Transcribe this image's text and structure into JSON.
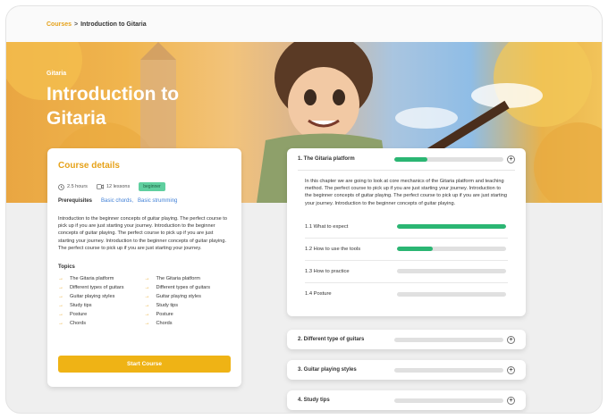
{
  "breadcrumb": {
    "link": "Courses",
    "separator": ">",
    "current": "Introduction to Gitaria"
  },
  "hero": {
    "subtitle": "Gitaria",
    "title": "Introduction to Gitaria"
  },
  "details": {
    "heading": "Course details",
    "duration": "2.5 hours",
    "lessons_count": "12 lessons",
    "level": "beginner",
    "prereq_label": "Prerequisites",
    "prereqs": [
      "Basic chords,",
      "Basic strumming"
    ],
    "description": "Introduction to the beginner concepts of guitar playing. The perfect course to pick up if you are just starting your journey. Introduction to the beginner concepts of guitar playing. The perfect course to pick up if you are just starting your journey. Introduction to the beginner concepts of guitar playing. The perfect course to pick up if you are just starting your journey.",
    "topics_label": "Topics",
    "topics_left": [
      "The Gitaria platform",
      "Different types of guitars",
      "Guitar playing styles",
      "Study tips",
      "Posture",
      "Chords"
    ],
    "topics_right": [
      "The Gitaria platform",
      "Different types of guitars",
      "Guitar playing styles",
      "Study tips",
      "Posture",
      "Chords"
    ],
    "start_button": "Start Course"
  },
  "chapters": [
    {
      "title": "1. The Gitaria platform",
      "progress": 0.3,
      "description": "In this chapter we are going to look at core mechanics of the Gitaria platform and teaching method. The perfect course to pick up if you are just starting your journey. Introduction to the beginner concepts of guitar playing. The perfect course to pick up if you are just starting your journey. Introduction to the beginner concepts of guitar playing.",
      "lessons": [
        {
          "title": "1.1  What to expect",
          "progress": 1.0
        },
        {
          "title": "1.2  How to use the tools",
          "progress": 0.33
        },
        {
          "title": "1.3  How to practice",
          "progress": 0
        },
        {
          "title": "1.4  Posture",
          "progress": 0
        }
      ]
    },
    {
      "title": "2.  Different type of guitars",
      "progress": 0
    },
    {
      "title": "3.  Guitar playing styles",
      "progress": 0
    },
    {
      "title": "4.  Study tips",
      "progress": 0
    }
  ],
  "colors": {
    "accent": "#e6a21a",
    "progress": "#2bb673",
    "button": "#efb315"
  },
  "icons": {
    "clock": "clock-icon",
    "video": "video-icon",
    "plus": "plus-circle-icon",
    "arrow": "arrow-right-icon"
  }
}
